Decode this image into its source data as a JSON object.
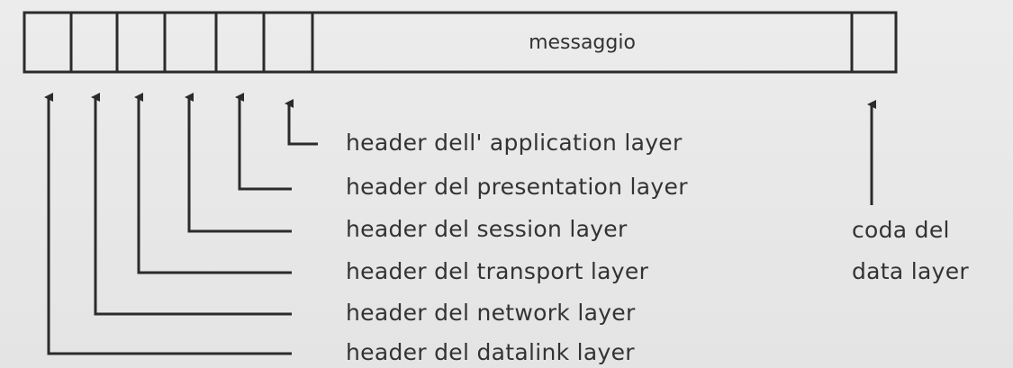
{
  "packet": {
    "message_label": "messaggio"
  },
  "headers": [
    "header dell' application layer",
    "header del presentation layer",
    "header del session layer",
    "header del transport layer",
    "header del network layer",
    "header del datalink layer"
  ],
  "trailer": {
    "line1": "coda del",
    "line2": "data layer"
  },
  "colors": {
    "line": "#2b2b2b",
    "background": "#e9e9e9"
  }
}
